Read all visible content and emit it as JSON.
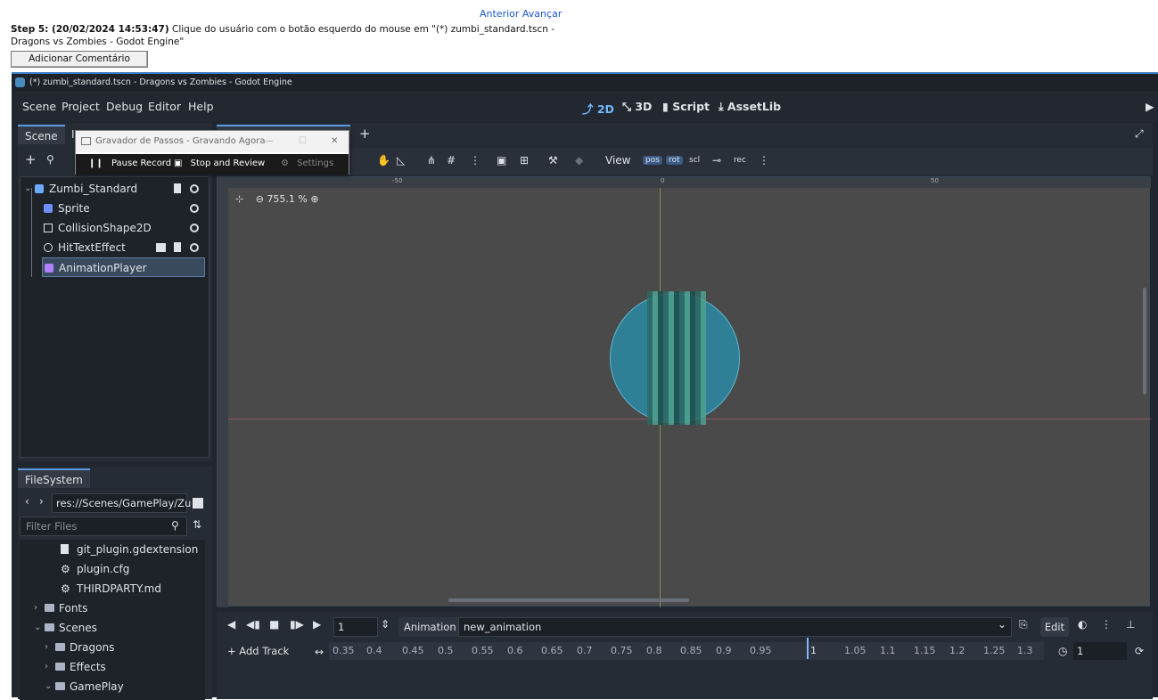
{
  "step": {
    "nav_prev": "Anterior",
    "nav_next": "Avançar",
    "label": "Step 5: (20/02/2024 14:53:47)",
    "description": "Clique do usuário com o botão esquerdo do mouse em \"(*) zumbi_standard.tscn - Dragons vs Zombies - Godot Engine\"",
    "add_comment": "Adicionar Comentário"
  },
  "window": {
    "title": "(*) zumbi_standard.tscn - Dragons vs Zombies - Godot Engine"
  },
  "menu": [
    "Scene",
    "Project",
    "Debug",
    "Editor",
    "Help"
  ],
  "workspaces": [
    {
      "label": "2D",
      "active": true
    },
    {
      "label": "3D",
      "active": false
    },
    {
      "label": "Script",
      "active": false
    },
    {
      "label": "AssetLib",
      "active": false
    }
  ],
  "scene_dock": {
    "tab": "Scene",
    "tab2": "I",
    "nodes": [
      "Zumbi_Standard",
      "Sprite",
      "CollisionShape2D",
      "HitTextEffect",
      "AnimationPlayer"
    ],
    "selected": "AnimationPlayer"
  },
  "filesystem": {
    "tab": "FileSystem",
    "path": "res://Scenes/GamePlay/Zu",
    "filter_placeholder": "Filter Files",
    "items": [
      "git_plugin.gdextension",
      "plugin.cfg",
      "THIRDPARTY.md",
      "Fonts",
      "Scenes",
      "Dragons",
      "Effects",
      "GamePlay"
    ]
  },
  "viewport": {
    "view_menu": "View",
    "zoom": "755.1 %",
    "toggles": [
      "pos",
      "rot",
      "scl",
      "rec"
    ],
    "ruler_ticks": [
      "-50",
      "0",
      "50"
    ]
  },
  "animation": {
    "frame": "1",
    "label": "Animation",
    "current": "new_animation",
    "edit": "Edit",
    "add_track": "Add Track",
    "ticks": [
      "0.35",
      "0.4",
      "0.45",
      "0.5",
      "0.55",
      "0.6",
      "0.65",
      "0.7",
      "0.75",
      "0.8",
      "0.85",
      "0.9",
      "0.95",
      "1",
      "1.05",
      "1.1",
      "1.15",
      "1.2",
      "1.25",
      "1.3"
    ],
    "length": "1"
  },
  "recorder": {
    "title": "Gravador de Passos - Gravando Agora",
    "pause": "Pause Record",
    "stop": "Stop and Review",
    "settings": "Settings"
  },
  "colors": {
    "accent": "#5a9ae0",
    "active_workspace": "#6fb8ff",
    "link": "#1a56c8"
  }
}
